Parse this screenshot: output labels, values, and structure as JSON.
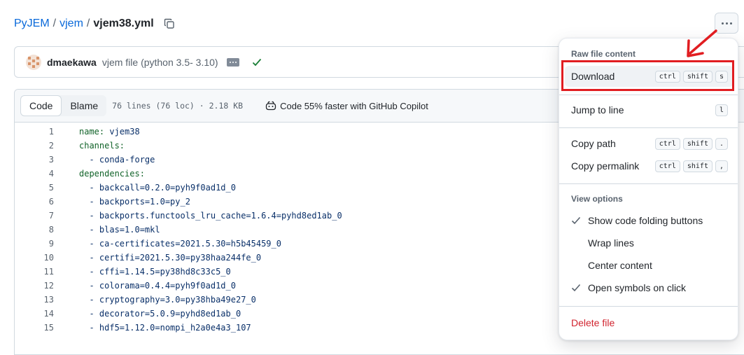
{
  "breadcrumb": {
    "repo": "PyJEM",
    "sep1": "/",
    "folder": "vjem",
    "sep2": "/",
    "file": "vjem38.yml"
  },
  "commit": {
    "author": "dmaekawa",
    "message": "vjem file (python 3.5- 3.10)"
  },
  "file_header": {
    "tab_code": "Code",
    "tab_blame": "Blame",
    "meta": "76 lines (76 loc) · 2.18 KB",
    "copilot": "Code 55% faster with GitHub Copilot"
  },
  "code_lines": [
    {
      "n": "1",
      "key": "name:",
      "val": " vjem38",
      "indent": ""
    },
    {
      "n": "2",
      "key": "channels:",
      "val": "",
      "indent": ""
    },
    {
      "n": "3",
      "key": "",
      "val": "  - conda-forge",
      "indent": ""
    },
    {
      "n": "4",
      "key": "dependencies:",
      "val": "",
      "indent": ""
    },
    {
      "n": "5",
      "key": "",
      "val": "  - backcall=0.2.0=pyh9f0ad1d_0",
      "indent": ""
    },
    {
      "n": "6",
      "key": "",
      "val": "  - backports=1.0=py_2",
      "indent": ""
    },
    {
      "n": "7",
      "key": "",
      "val": "  - backports.functools_lru_cache=1.6.4=pyhd8ed1ab_0",
      "indent": ""
    },
    {
      "n": "8",
      "key": "",
      "val": "  - blas=1.0=mkl",
      "indent": ""
    },
    {
      "n": "9",
      "key": "",
      "val": "  - ca-certificates=2021.5.30=h5b45459_0",
      "indent": ""
    },
    {
      "n": "10",
      "key": "",
      "val": "  - certifi=2021.5.30=py38haa244fe_0",
      "indent": ""
    },
    {
      "n": "11",
      "key": "",
      "val": "  - cffi=1.14.5=py38hd8c33c5_0",
      "indent": ""
    },
    {
      "n": "12",
      "key": "",
      "val": "  - colorama=0.4.4=pyh9f0ad1d_0",
      "indent": ""
    },
    {
      "n": "13",
      "key": "",
      "val": "  - cryptography=3.0=py38hba49e27_0",
      "indent": ""
    },
    {
      "n": "14",
      "key": "",
      "val": "  - decorator=5.0.9=pyhd8ed1ab_0",
      "indent": ""
    },
    {
      "n": "15",
      "key": "",
      "val": "  - hdf5=1.12.0=nompi_h2a0e4a3_107",
      "indent": ""
    }
  ],
  "menu": {
    "raw_heading": "Raw file content",
    "download": {
      "label": "Download",
      "keys": [
        "ctrl",
        "shift",
        "s"
      ]
    },
    "jump": {
      "label": "Jump to line",
      "keys": [
        "l"
      ]
    },
    "copy_path": {
      "label": "Copy path",
      "keys": [
        "ctrl",
        "shift",
        "."
      ]
    },
    "copy_permalink": {
      "label": "Copy permalink",
      "keys": [
        "ctrl",
        "shift",
        ","
      ]
    },
    "view_heading": "View options",
    "show_folding": {
      "label": "Show code folding buttons",
      "checked": true
    },
    "wrap_lines": {
      "label": "Wrap lines",
      "checked": false
    },
    "center_content": {
      "label": "Center content",
      "checked": false
    },
    "open_symbols": {
      "label": "Open symbols on click",
      "checked": true
    },
    "delete": {
      "label": "Delete file"
    }
  },
  "colors": {
    "link": "#0969da",
    "annotation": "#e11d21",
    "danger": "#d1242f",
    "success": "#1a7f37"
  }
}
